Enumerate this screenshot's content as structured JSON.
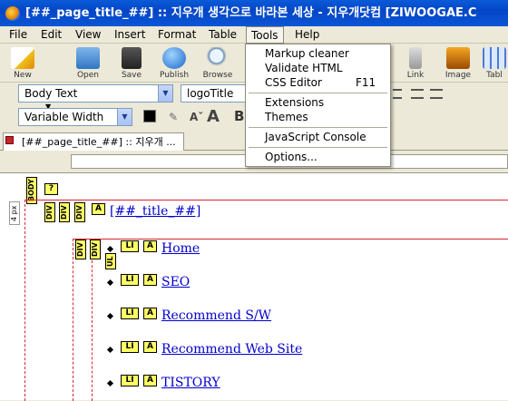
{
  "window": {
    "title": "[##_page_title_##] :: 지우개 생각으로 바라본 세상 - 지우개닷컴 [ZIWOOGAE.C"
  },
  "menubar": [
    {
      "label": "File"
    },
    {
      "label": "Edit"
    },
    {
      "label": "View"
    },
    {
      "label": "Insert"
    },
    {
      "label": "Format"
    },
    {
      "label": "Table"
    },
    {
      "label": "Tools"
    },
    {
      "label": "Help"
    }
  ],
  "toolbar": {
    "new": "New",
    "open": "Open",
    "save": "Save",
    "publish": "Publish",
    "browse": "Browse",
    "link": "Link",
    "image": "Image",
    "table": "Tabl"
  },
  "format": {
    "paragraph": "Body Text",
    "class": "logoTitle",
    "width": "Variable Width",
    "bold": "B"
  },
  "tools_menu": {
    "markup_cleaner": "Markup cleaner",
    "validate_html": "Validate HTML",
    "css_editor": "CSS Editor",
    "css_editor_shortcut": "F11",
    "extensions": "Extensions",
    "themes": "Themes",
    "js_console": "JavaScript Console",
    "options": "Options..."
  },
  "tab": {
    "label": "[##_page_title_##] :: 지우개 ..."
  },
  "editor": {
    "body_tag": "BODY",
    "question": "?",
    "ruler": "4 px",
    "div": "DIV",
    "ul": "UL",
    "li": "LI",
    "a": "A",
    "title_link": "[##_title_##]",
    "items": [
      {
        "label": "Home"
      },
      {
        "label": "SEO"
      },
      {
        "label": "Recommend S/W"
      },
      {
        "label": "Recommend Web Site"
      },
      {
        "label": "TISTORY"
      }
    ]
  }
}
